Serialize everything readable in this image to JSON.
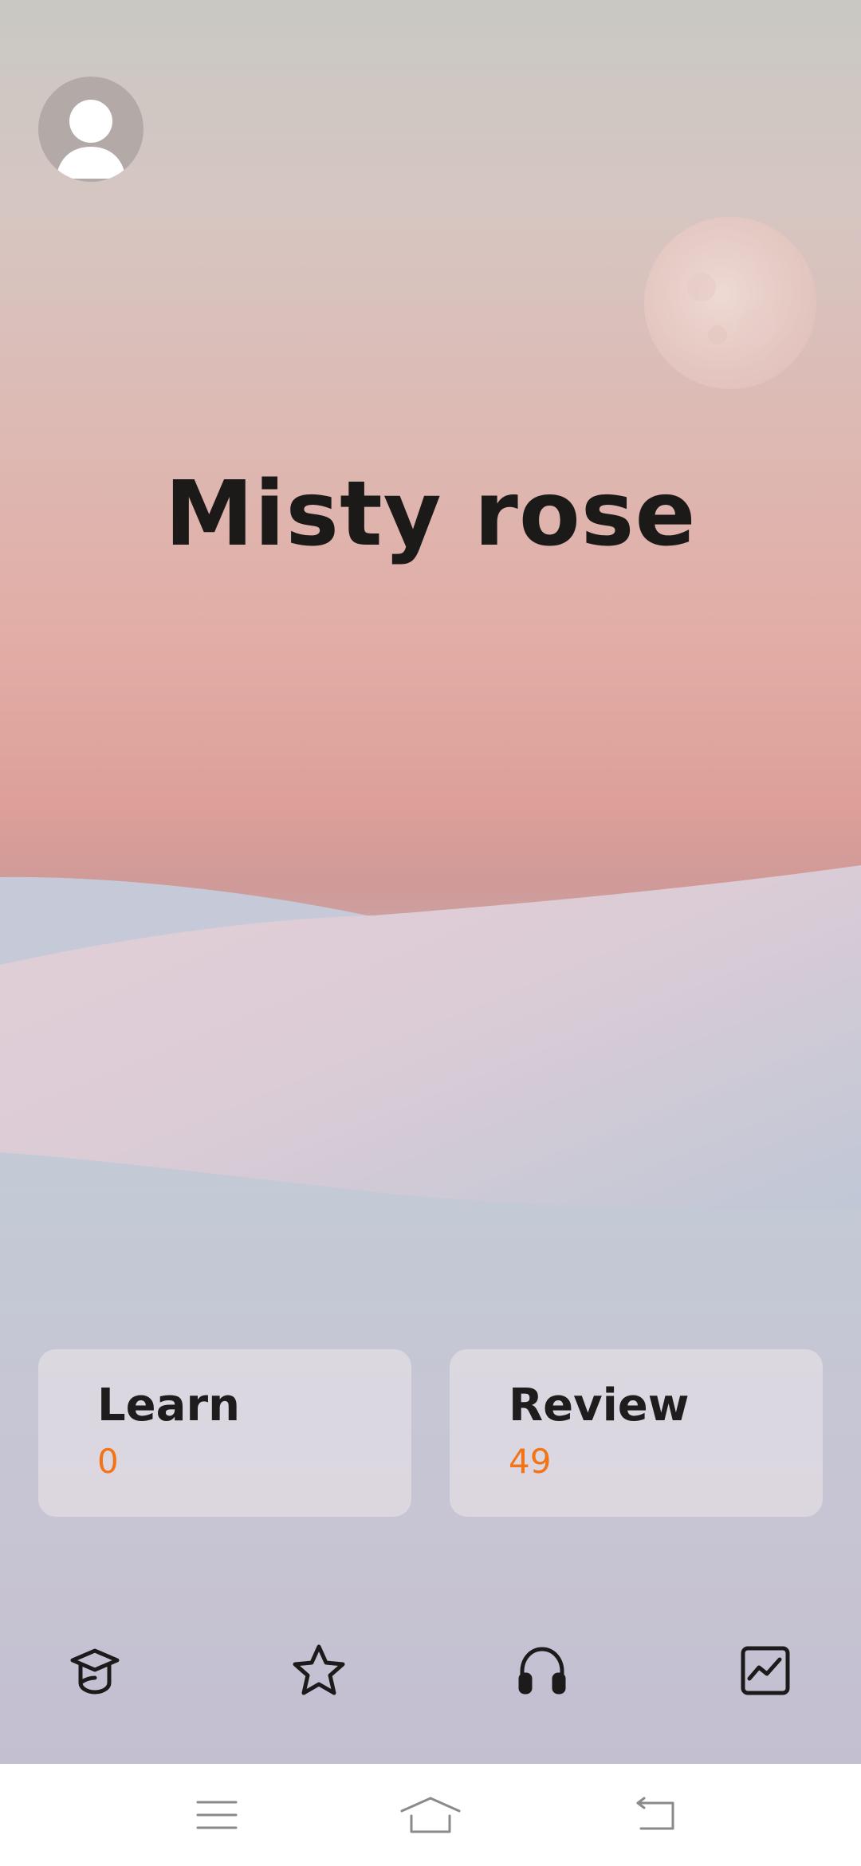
{
  "header": {
    "avatar_icon": "user-avatar-icon",
    "title": "Misty rose"
  },
  "cards": {
    "learn": {
      "label": "Learn",
      "count": "0"
    },
    "review": {
      "label": "Review",
      "count": "49"
    }
  },
  "tabbar": {
    "tabs": [
      {
        "name": "learn",
        "icon": "graduation-cap-icon"
      },
      {
        "name": "favorites",
        "icon": "star-icon"
      },
      {
        "name": "listen",
        "icon": "headphones-icon"
      },
      {
        "name": "statistics",
        "icon": "chart-icon"
      }
    ]
  },
  "system_nav": {
    "buttons": [
      {
        "name": "menu",
        "icon": "menu-icon"
      },
      {
        "name": "home",
        "icon": "home-icon"
      },
      {
        "name": "back",
        "icon": "back-icon"
      }
    ]
  },
  "colors": {
    "accent_count": "#f37416",
    "title_text": "#1c1a18",
    "sky_top": "#c9c8c3",
    "sky_mid": "#e2aca5",
    "dunes": "#c8c3cf"
  }
}
